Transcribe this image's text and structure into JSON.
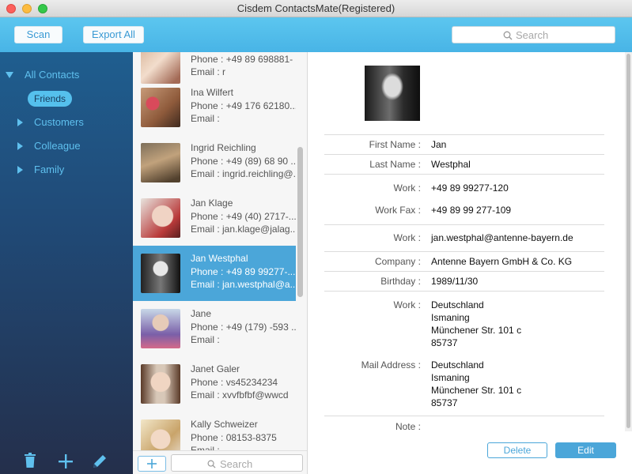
{
  "window": {
    "title": "Cisdem ContactsMate(Registered)"
  },
  "toolbar": {
    "scan_label": "Scan",
    "export_label": "Export All",
    "search_placeholder": "Search"
  },
  "sidebar": {
    "all_contacts": "All Contacts",
    "groups": [
      "Friends",
      "Customers",
      "Colleague",
      "Family"
    ]
  },
  "list": {
    "search_placeholder": "Search",
    "rows": [
      {
        "name": "",
        "phone": "Phone : +49 89 698881-",
        "email": "Email : r"
      },
      {
        "name": "Ina Wilfert",
        "phone": "Phone : +49 176 62180...",
        "email": "Email :"
      },
      {
        "name": "Ingrid Reichling",
        "phone": "Phone : +49 (89) 68 90 ...",
        "email": "Email : ingrid.reichling@..."
      },
      {
        "name": "Jan Klage",
        "phone": "Phone : +49 (40) 2717-...",
        "email": "Email : jan.klage@jalag..."
      },
      {
        "name": "Jan Westphal",
        "phone": "Phone : +49 89 99277-...",
        "email": "Email : jan.westphal@a..."
      },
      {
        "name": "Jane",
        "phone": "Phone : +49 (179) -593 ...",
        "email": "Email :"
      },
      {
        "name": "Janet Galer",
        "phone": "Phone : vs45234234",
        "email": "Email : xvvfbfbf@wwcd"
      },
      {
        "name": "Kally Schweizer",
        "phone": "Phone : 08153-8375",
        "email": "Email :"
      }
    ]
  },
  "detail": {
    "first_name_label": "First Name",
    "first_name": "Jan",
    "last_name_label": "Last Name",
    "last_name": "Westphal",
    "work_phone_label": "Work",
    "work_phone": "+49 89 99277-120",
    "work_fax_label": "Work Fax",
    "work_fax": "+49 89 99 277-109",
    "work_email_label": "Work",
    "work_email": "jan.westphal@antenne-bayern.de",
    "company_label": "Company",
    "company": "Antenne Bayern GmbH & Co. KG",
    "birthday_label": "Birthday",
    "birthday": "1989/11/30",
    "work_address_label": "Work",
    "work_address": [
      "Deutschland",
      "Ismaning",
      "Münchener Str. 101 c",
      "85737"
    ],
    "mail_address_label": "Mail Address",
    "mail_address": [
      "Deutschland",
      "Ismaning",
      "Münchener Str. 101 c",
      "85737"
    ],
    "note_label": "Note",
    "colon": ":",
    "delete_label": "Delete",
    "edit_label": "Edit"
  },
  "colors": {
    "accent": "#4ba6d9",
    "toolbar": "#55bdeb",
    "sidebar_top": "#1f5e8f",
    "sidebar_bottom": "#242f4b",
    "sidebar_text": "#5fc0ee"
  },
  "icons": [
    "search-icon",
    "trash-icon",
    "plus-icon",
    "pencil-icon",
    "disclosure-triangle-icon"
  ]
}
